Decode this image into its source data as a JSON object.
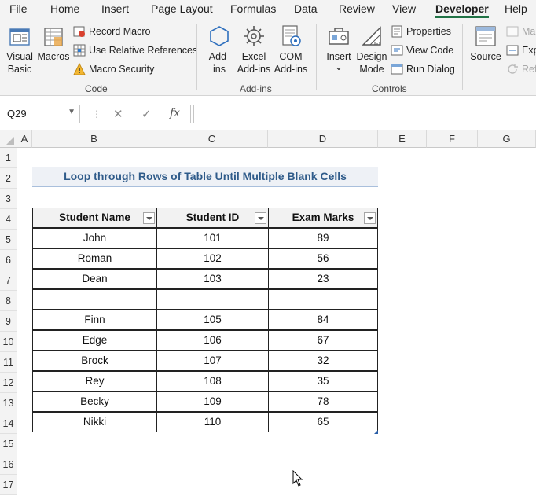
{
  "menu": {
    "tabs": [
      "File",
      "Home",
      "Insert",
      "Page Layout",
      "Formulas",
      "Data",
      "Review",
      "View",
      "Developer",
      "Help"
    ],
    "active": "Developer"
  },
  "ribbon": {
    "code": {
      "visual_basic": [
        "Visual",
        "Basic"
      ],
      "macros": "Macros",
      "record_macro": "Record Macro",
      "use_relative": "Use Relative References",
      "macro_security": "Macro Security",
      "group_label": "Code"
    },
    "addins": {
      "addins": [
        "Add-",
        "ins"
      ],
      "excel_addins": [
        "Excel",
        "Add-ins"
      ],
      "com_addins": [
        "COM",
        "Add-ins"
      ],
      "group_label": "Add-ins"
    },
    "controls": {
      "insert": "Insert",
      "insert_caret": "⌄",
      "design_mode": [
        "Design",
        "Mode"
      ],
      "properties": "Properties",
      "view_code": "View Code",
      "run_dialog": "Run Dialog",
      "group_label": "Controls"
    },
    "xml": {
      "source": "Source",
      "map": "Map",
      "expa": "Expa",
      "refr": "Refr"
    }
  },
  "formula_bar": {
    "name_box": "Q29",
    "cancel": "✕",
    "enter": "✓",
    "fx": "fx",
    "formula": ""
  },
  "sheet": {
    "columns": [
      "A",
      "B",
      "C",
      "D",
      "E",
      "F",
      "G"
    ],
    "rows": [
      "1",
      "2",
      "3",
      "4",
      "5",
      "6",
      "7",
      "8",
      "9",
      "10",
      "11",
      "12",
      "13",
      "14",
      "15",
      "16",
      "17"
    ],
    "title": "Loop through Rows of Table Until Multiple Blank Cells",
    "table": {
      "headers": [
        "Student Name",
        "Student ID",
        "Exam Marks"
      ],
      "rows": [
        [
          "John",
          "101",
          "89"
        ],
        [
          "Roman",
          "102",
          "56"
        ],
        [
          "Dean",
          "103",
          "23"
        ],
        [
          "",
          "",
          ""
        ],
        [
          "Finn",
          "105",
          "84"
        ],
        [
          "Edge",
          "106",
          "67"
        ],
        [
          "Brock",
          "107",
          "32"
        ],
        [
          "Rey",
          "108",
          "35"
        ],
        [
          "Becky",
          "109",
          "78"
        ],
        [
          "Nikki",
          "110",
          "65"
        ]
      ]
    }
  },
  "colors": {
    "accent": "#217346",
    "title_text": "#2f5b8a",
    "title_underline": "#a9bfdc"
  }
}
